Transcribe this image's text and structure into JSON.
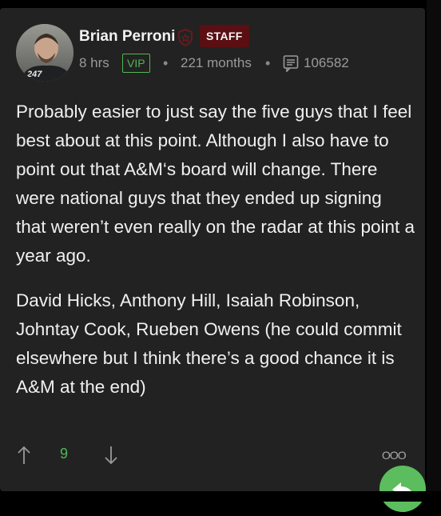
{
  "post": {
    "author": {
      "name": "Brian Perroni",
      "badge": "STAFF",
      "avatar_text": "247",
      "role_icon": "shield-icon"
    },
    "meta": {
      "time": "8 hrs",
      "tier": "VIP",
      "tenure": "221 months",
      "post_count": "106582",
      "post_count_icon": "posts-icon"
    },
    "body": {
      "paragraph1": "Probably easier to just say the five guys that I feel best about at this point. Although I also have to point out that A&M‘s board will change. There were national guys that they ended up signing that weren’t even really on the radar at this point a year ago.",
      "paragraph2": "David Hicks, Anthony Hill, Isaiah Robinson, Johntay Cook, Rueben Owens (he could commit elsewhere but I think there’s a good chance it is A&M at the end)"
    },
    "actions": {
      "upvote_icon": "arrow-up-icon",
      "vote_count": "9",
      "downvote_icon": "arrow-down-icon",
      "more_label": "OOO",
      "reply_icon": "reply-icon"
    }
  },
  "colors": {
    "background": "#000000",
    "card": "#232222",
    "accent_green": "#4fb653",
    "staff_red": "#5b0f12",
    "text": "#f0f0f0",
    "muted": "#9a9a9a"
  }
}
